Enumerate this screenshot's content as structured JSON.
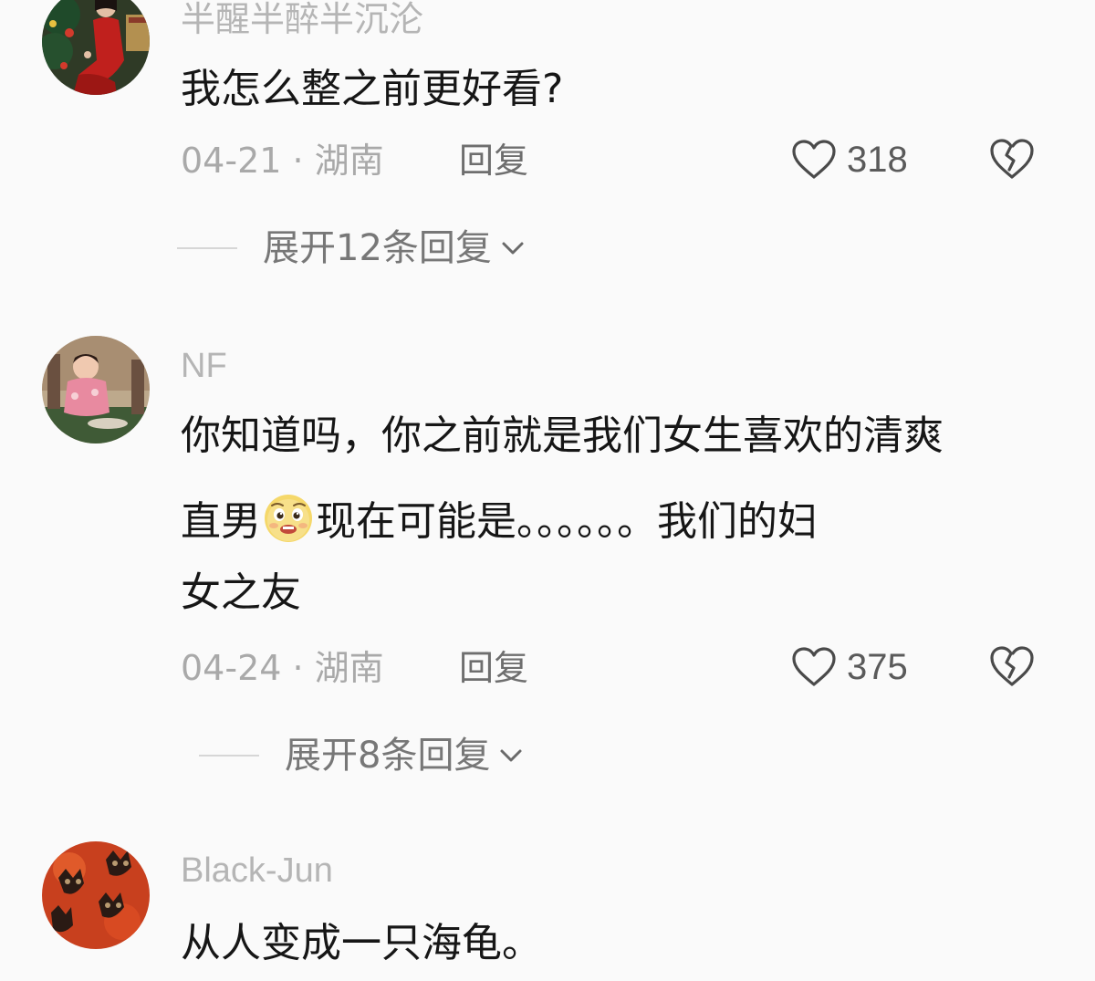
{
  "comments": [
    {
      "username": "半醒半醉半沉沦",
      "text_lines": [
        "我怎么整之前更好看?"
      ],
      "date": "04-21",
      "location": "湖南",
      "reply_label": "回复",
      "likes": "318",
      "expand_label": "展开12条回复"
    },
    {
      "username": "NF",
      "text_lines": [
        "你知道吗，你之前就是我们女生喜欢的清爽",
        "直男",
        "现在可能是。。。。。。我们的妇",
        "女之友"
      ],
      "date": "04-24",
      "location": "湖南",
      "reply_label": "回复",
      "likes": "375",
      "expand_label": "展开8条回复"
    },
    {
      "username": "Black-Jun",
      "text_lines": [
        "从人变成一只海龟。"
      ]
    }
  ],
  "meta_separator": " · ",
  "icons": {
    "like": "heart-outline-icon",
    "dislike": "broken-heart-icon",
    "expand": "chevron-down-icon",
    "emoji": "pleading-face-emoji"
  }
}
